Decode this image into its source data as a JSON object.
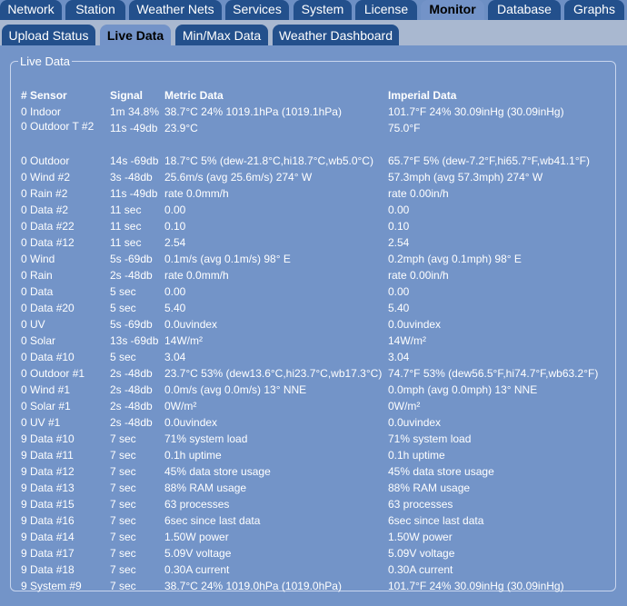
{
  "top_tabs": [
    {
      "label": "Network",
      "active": false
    },
    {
      "label": "Station",
      "active": false
    },
    {
      "label": "Weather Nets",
      "active": false
    },
    {
      "label": "Services",
      "active": false
    },
    {
      "label": "System",
      "active": false
    },
    {
      "label": "License",
      "active": false
    },
    {
      "label": "Monitor",
      "active": true
    },
    {
      "label": "Database",
      "active": false
    },
    {
      "label": "Graphs",
      "active": false
    }
  ],
  "sub_tabs": [
    {
      "label": "Upload Status",
      "active": false
    },
    {
      "label": "Live Data",
      "active": true
    },
    {
      "label": "Min/Max Data",
      "active": false
    },
    {
      "label": "Weather Dashboard",
      "active": false
    }
  ],
  "panel": {
    "legend": "Live Data",
    "columns": [
      "# Sensor",
      "Signal",
      "Metric Data",
      "Imperial Data"
    ],
    "rows": [
      [
        "0 Indoor",
        "1m 34.8%",
        "38.7°C 24% 1019.1hPa (1019.1hPa)",
        "101.7°F 24% 30.09inHg (30.09inHg)"
      ],
      [
        "0 Outdoor T #2",
        "11s -49db",
        "23.9°C",
        "75.0°F"
      ],
      [
        "0 Outdoor",
        "14s -69db",
        "18.7°C 5% (dew-21.8°C,hi18.7°C,wb5.0°C)",
        "65.7°F 5% (dew-7.2°F,hi65.7°F,wb41.1°F)"
      ],
      [
        "0 Wind #2",
        "3s -48db",
        "25.6m/s (avg 25.6m/s) 274° W",
        "57.3mph (avg 57.3mph) 274° W"
      ],
      [
        "0 Rain #2",
        "11s -49db",
        "rate 0.0mm/h",
        "rate 0.00in/h"
      ],
      [
        "0 Data #2",
        "11 sec",
        "0.00",
        "0.00"
      ],
      [
        "0 Data #22",
        "11 sec",
        "0.10",
        "0.10"
      ],
      [
        "0 Data #12",
        "11 sec",
        "2.54",
        "2.54"
      ],
      [
        "0 Wind",
        "5s -69db",
        "0.1m/s (avg 0.1m/s) 98° E",
        "0.2mph (avg 0.1mph) 98° E"
      ],
      [
        "0 Rain",
        "2s -48db",
        "rate 0.0mm/h",
        "rate 0.00in/h"
      ],
      [
        "0 Data",
        "5 sec",
        "0.00",
        "0.00"
      ],
      [
        "0 Data #20",
        "5 sec",
        "5.40",
        "5.40"
      ],
      [
        "0 UV",
        "5s -69db",
        "0.0uvindex",
        "0.0uvindex"
      ],
      [
        "0 Solar",
        "13s -69db",
        "14W/m²",
        "14W/m²"
      ],
      [
        "0 Data #10",
        "5 sec",
        "3.04",
        "3.04"
      ],
      [
        "0 Outdoor #1",
        "2s -48db",
        "23.7°C 53% (dew13.6°C,hi23.7°C,wb17.3°C)",
        "74.7°F 53% (dew56.5°F,hi74.7°F,wb63.2°F)"
      ],
      [
        "0 Wind #1",
        "2s -48db",
        "0.0m/s (avg 0.0m/s) 13° NNE",
        "0.0mph (avg 0.0mph) 13° NNE"
      ],
      [
        "0 Solar #1",
        "2s -48db",
        "0W/m²",
        "0W/m²"
      ],
      [
        "0 UV #1",
        "2s -48db",
        "0.0uvindex",
        "0.0uvindex"
      ],
      [
        "9 Data #10",
        "7 sec",
        "71% system load",
        "71% system load"
      ],
      [
        "9 Data #11",
        "7 sec",
        "0.1h uptime",
        "0.1h uptime"
      ],
      [
        "9 Data #12",
        "7 sec",
        "45% data store usage",
        "45% data store usage"
      ],
      [
        "9 Data #13",
        "7 sec",
        "88% RAM usage",
        "88% RAM usage"
      ],
      [
        "9 Data #15",
        "7 sec",
        "63 processes",
        "63 processes"
      ],
      [
        "9 Data #16",
        "7 sec",
        "6sec since last data",
        "6sec since last data"
      ],
      [
        "9 Data #14",
        "7 sec",
        "1.50W power",
        "1.50W power"
      ],
      [
        "9 Data #17",
        "7 sec",
        "5.09V voltage",
        "5.09V voltage"
      ],
      [
        "9 Data #18",
        "7 sec",
        "0.30A current",
        "0.30A current"
      ],
      [
        "9 System #9",
        "7 sec",
        "38.7°C 24% 1019.0hPa (1019.0hPa)",
        "101.7°F 24% 30.09inHg (30.09inHg)"
      ]
    ]
  }
}
